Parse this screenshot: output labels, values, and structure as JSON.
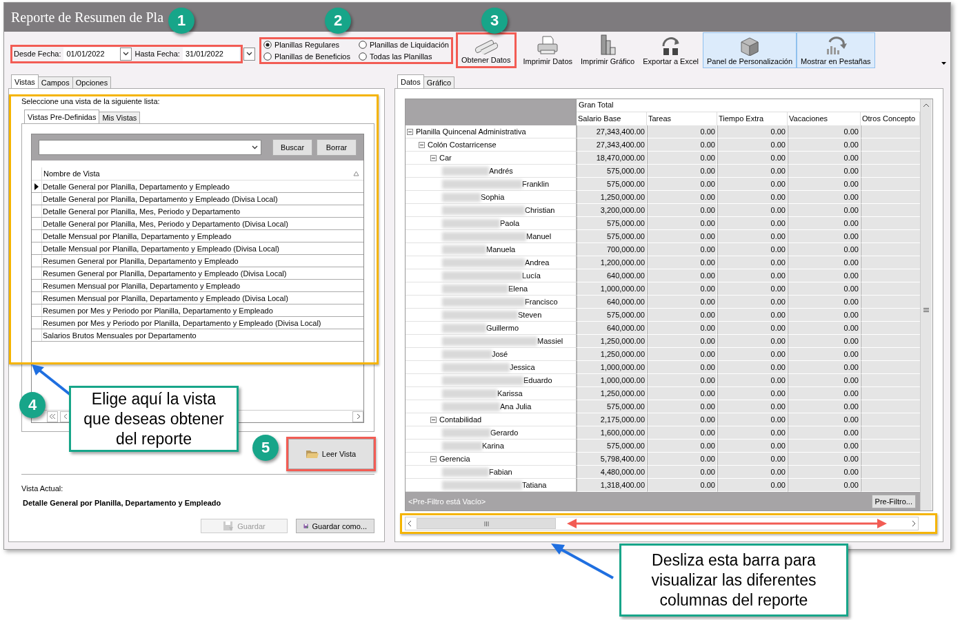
{
  "window": {
    "title": "Reporte de Resumen de Pla"
  },
  "date_range": {
    "from_label": "Desde Fecha:",
    "from_value": "01/01/2022",
    "to_label": "Hasta Fecha:",
    "to_value": "31/01/2022"
  },
  "payroll_types": [
    {
      "label": "Planillas Regulares",
      "selected": true
    },
    {
      "label": "Planillas de Liquidación",
      "selected": false
    },
    {
      "label": "Planillas de Beneficios",
      "selected": false
    },
    {
      "label": "Todas las Planillas",
      "selected": false
    }
  ],
  "toolbar": [
    {
      "label": "Obtener Datos",
      "kind": "pipes",
      "active": false
    },
    {
      "label": "Imprimir Datos",
      "kind": "printer",
      "active": false
    },
    {
      "label": "Imprimir Gráfico",
      "kind": "chart",
      "active": false
    },
    {
      "label": "Exportar a Excel",
      "kind": "export",
      "active": false
    },
    {
      "label": "Panel de Personalización",
      "kind": "cubes",
      "active": true
    },
    {
      "label": "Mostrar en Pestañas",
      "kind": "bars",
      "active": true
    }
  ],
  "left_tabs": [
    {
      "label": "Vistas",
      "selected": true
    },
    {
      "label": "Campos",
      "selected": false
    },
    {
      "label": "Opciones",
      "selected": false
    }
  ],
  "views_panel": {
    "prompt": "Seleccione una vista de la siguiente lista:",
    "subtabs": [
      {
        "label": "Vistas Pre-Definidas",
        "selected": true
      },
      {
        "label": "Mis Vistas",
        "selected": false
      }
    ],
    "search_buttons": [
      "Buscar",
      "Borrar"
    ],
    "column": "Nombre de Vista",
    "rows": [
      {
        "name": "Detalle General por Planilla, Departamento y Empleado",
        "selected": true
      },
      {
        "name": "Detalle General por Planilla, Departamento y Empleado (Divisa Local)",
        "selected": false
      },
      {
        "name": "Detalle General por Planilla, Mes, Periodo y Departamento",
        "selected": false
      },
      {
        "name": "Detalle General por Planilla, Mes, Periodo y Departamento (Divisa Local)",
        "selected": false
      },
      {
        "name": "Detalle Mensual por Planilla, Departamento y Empleado",
        "selected": false
      },
      {
        "name": "Detalle Mensual por Planilla, Departamento y Empleado (Divisa Local)",
        "selected": false
      },
      {
        "name": "Resumen General por Planilla, Departamento y Empleado",
        "selected": false
      },
      {
        "name": "Resumen General por Planilla, Departamento y Empleado (Divisa Local)",
        "selected": false
      },
      {
        "name": "Resumen Mensual por Planilla, Departamento y Empleado",
        "selected": false
      },
      {
        "name": "Resumen Mensual por Planilla, Departamento y Empleado (Divisa Local)",
        "selected": false
      },
      {
        "name": "Resumen por Mes y Periodo por Planilla, Departamento y Empleado",
        "selected": false
      },
      {
        "name": "Resumen por Mes y Periodo por Planilla, Departamento y Empleado (Divisa Local)",
        "selected": false
      },
      {
        "name": "Salarios Brutos Mensuales por Departamento",
        "selected": false
      }
    ],
    "load_button": "Leer Vista",
    "current_label": "Vista Actual:",
    "current_value": "Detalle General por Planilla, Departamento y Empleado",
    "save_buttons": [
      {
        "label": "Guardar",
        "disabled": true
      },
      {
        "label": "Guardar como...",
        "disabled": false
      }
    ]
  },
  "right_tabs": [
    {
      "label": "Datos",
      "selected": true
    },
    {
      "label": "Gráfico",
      "selected": false
    }
  ],
  "pivot": {
    "grand_total": "Gran Total",
    "columns": [
      "Salario Base",
      "Tareas",
      "Tiempo Extra",
      "Vacaciones",
      "Otros Concepto"
    ],
    "rows": [
      {
        "label": "Planilla Quincenal Administrativa",
        "kind": "group",
        "expanded": true,
        "values": [
          "27,343,400.00",
          "0.00",
          "0.00",
          "0.00"
        ],
        "children": [
          {
            "label": "Colón Costarricense",
            "kind": "group",
            "expanded": true,
            "values": [
              "27,343,400.00",
              "0.00",
              "0.00",
              "0.00"
            ],
            "children": [
              {
                "label": "Car",
                "kind": "group",
                "expanded": true,
                "values": [
                  "18,470,000.00",
                  "0.00",
                  "0.00",
                  "0.00"
                ],
                "children": [
                  {
                    "label": "Andrés",
                    "kind": "employee",
                    "values": [
                      "575,000.00",
                      "0.00",
                      "0.00",
                      "0.00"
                    ]
                  },
                  {
                    "label": "Franklin",
                    "kind": "employee",
                    "values": [
                      "575,000.00",
                      "0.00",
                      "0.00",
                      "0.00"
                    ]
                  },
                  {
                    "label": "Sophia",
                    "kind": "employee",
                    "values": [
                      "1,250,000.00",
                      "0.00",
                      "0.00",
                      "0.00"
                    ]
                  },
                  {
                    "label": "Christian",
                    "kind": "employee",
                    "values": [
                      "3,200,000.00",
                      "0.00",
                      "0.00",
                      "0.00"
                    ]
                  },
                  {
                    "label": "Paola",
                    "kind": "employee",
                    "values": [
                      "575,000.00",
                      "0.00",
                      "0.00",
                      "0.00"
                    ]
                  },
                  {
                    "label": "Manuel",
                    "kind": "employee",
                    "values": [
                      "575,000.00",
                      "0.00",
                      "0.00",
                      "0.00"
                    ]
                  },
                  {
                    "label": "Manuela",
                    "kind": "employee",
                    "values": [
                      "700,000.00",
                      "0.00",
                      "0.00",
                      "0.00"
                    ]
                  },
                  {
                    "label": "Andrea",
                    "kind": "employee",
                    "values": [
                      "1,200,000.00",
                      "0.00",
                      "0.00",
                      "0.00"
                    ]
                  },
                  {
                    "label": "Lucía",
                    "kind": "employee",
                    "values": [
                      "640,000.00",
                      "0.00",
                      "0.00",
                      "0.00"
                    ]
                  },
                  {
                    "label": "Elena",
                    "kind": "employee",
                    "values": [
                      "1,000,000.00",
                      "0.00",
                      "0.00",
                      "0.00"
                    ]
                  },
                  {
                    "label": "Francisco",
                    "kind": "employee",
                    "values": [
                      "640,000.00",
                      "0.00",
                      "0.00",
                      "0.00"
                    ]
                  },
                  {
                    "label": "Steven",
                    "kind": "employee",
                    "values": [
                      "575,000.00",
                      "0.00",
                      "0.00",
                      "0.00"
                    ]
                  },
                  {
                    "label": "Guillermo",
                    "kind": "employee",
                    "values": [
                      "640,000.00",
                      "0.00",
                      "0.00",
                      "0.00"
                    ]
                  },
                  {
                    "label": "Massiel",
                    "kind": "employee",
                    "values": [
                      "1,250,000.00",
                      "0.00",
                      "0.00",
                      "0.00"
                    ]
                  },
                  {
                    "label": "José",
                    "kind": "employee",
                    "values": [
                      "1,250,000.00",
                      "0.00",
                      "0.00",
                      "0.00"
                    ]
                  },
                  {
                    "label": "Jessica",
                    "kind": "employee",
                    "values": [
                      "1,000,000.00",
                      "0.00",
                      "0.00",
                      "0.00"
                    ]
                  },
                  {
                    "label": "Eduardo",
                    "kind": "employee",
                    "values": [
                      "1,000,000.00",
                      "0.00",
                      "0.00",
                      "0.00"
                    ]
                  },
                  {
                    "label": "Karissa",
                    "kind": "employee",
                    "values": [
                      "1,250,000.00",
                      "0.00",
                      "0.00",
                      "0.00"
                    ]
                  },
                  {
                    "label": "Ana Julia",
                    "kind": "employee",
                    "values": [
                      "575,000.00",
                      "0.00",
                      "0.00",
                      "0.00"
                    ]
                  }
                ]
              },
              {
                "label": "Contabilidad",
                "kind": "group",
                "expanded": true,
                "values": [
                  "2,175,000.00",
                  "0.00",
                  "0.00",
                  "0.00"
                ],
                "children": [
                  {
                    "label": "Gerardo",
                    "kind": "employee",
                    "values": [
                      "1,600,000.00",
                      "0.00",
                      "0.00",
                      "0.00"
                    ]
                  },
                  {
                    "label": "Karina",
                    "kind": "employee",
                    "values": [
                      "575,000.00",
                      "0.00",
                      "0.00",
                      "0.00"
                    ]
                  }
                ]
              },
              {
                "label": "Gerencia",
                "kind": "group",
                "expanded": true,
                "values": [
                  "5,798,400.00",
                  "0.00",
                  "0.00",
                  "0.00"
                ],
                "children": [
                  {
                    "label": "Fabian",
                    "kind": "employee",
                    "values": [
                      "4,480,000.00",
                      "0.00",
                      "0.00",
                      "0.00"
                    ]
                  },
                  {
                    "label": "Tatiana",
                    "kind": "employee",
                    "values": [
                      "1,318,400.00",
                      "0.00",
                      "0.00",
                      "0.00"
                    ]
                  }
                ]
              }
            ]
          }
        ]
      }
    ],
    "prefilter": "<Pre-Filtro está Vacío>",
    "prefilter_button": "Pre-Filtro..."
  },
  "annotations": {
    "badges": [
      "1",
      "2",
      "3",
      "4",
      "5"
    ],
    "callouts": [
      "Elige aquí la vista que deseas obtener del reporte",
      "Desliza esta barra para visualizar las diferentes columnas del reporte"
    ]
  }
}
